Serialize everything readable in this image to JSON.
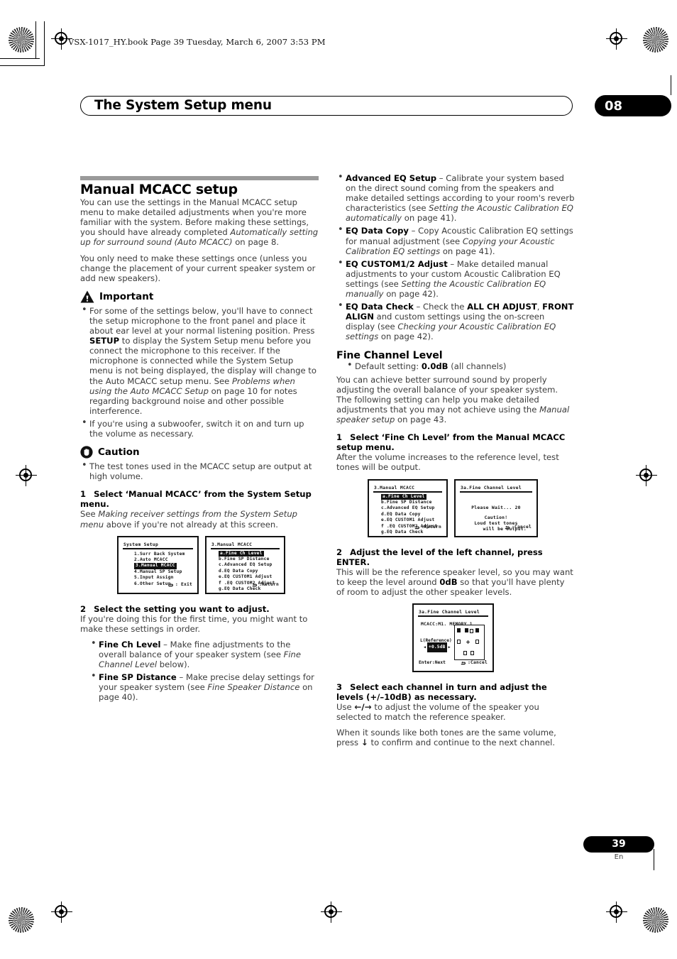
{
  "header": {
    "book_line": "VSX-1017_HY.book  Page 39  Tuesday, March 6, 2007  3:53 PM",
    "chapter_title": "The System Setup menu",
    "chapter_number": "08"
  },
  "footer": {
    "page_number": "39",
    "language": "En"
  },
  "left_column": {
    "section_title": "Manual MCACC setup",
    "intro_p1_a": "You can use the settings in the Manual MCACC setup menu to make detailed adjustments when you're more familiar with the system. Before making these settings, you should have already completed ",
    "intro_p1_italic": "Automatically setting up for surround sound (Auto MCACC)",
    "intro_p1_b": " on page 8.",
    "intro_p2": "You only need to make these settings once (unless you change the placement of your current speaker system or add new speakers).",
    "important_label": "Important",
    "important_bullet_1_a": "For some of the settings below, you'll have to connect the setup microphone to the front panel and place it about ear level at your normal listening position. Press ",
    "important_bullet_1_b": "SETUP",
    "important_bullet_1_c": " to display the System Setup menu before you connect the microphone to this receiver. If the microphone is connected while the System Setup menu is not being displayed, the display will change to the Auto MCACC setup menu. See ",
    "important_bullet_1_italic": "Problems when using the Auto MCACC Setup",
    "important_bullet_1_d": " on page 10 for notes regarding background noise and other possible interference.",
    "important_bullet_2": "If you're using a subwoofer, switch it on and turn up the volume as necessary.",
    "caution_label": "Caution",
    "caution_bullet_1": "The test tones used in the MCACC setup are output at high volume.",
    "step1_num": "1",
    "step1_title": "Select ‘Manual MCACC’ from the System Setup menu.",
    "step1_body_a": "See ",
    "step1_body_italic": "Making receiver settings from the System Setup menu",
    "step1_body_b": " above if you're not already at this screen.",
    "step2_num": "2",
    "step2_title": "Select the setting you want to adjust.",
    "step2_body": "If you're doing this for the first time, you might want to make these settings in order.",
    "step2_bullets": [
      {
        "bold": "Fine Ch Level",
        "text_a": " – Make fine adjustments to the overall balance of your speaker system (see ",
        "italic": "Fine Channel Level",
        "text_b": " below)."
      },
      {
        "bold": "Fine SP Distance",
        "text_a": " – Make precise delay settings for your speaker system (see ",
        "italic": "Fine Speaker Distance",
        "text_b": " on page 40)."
      }
    ]
  },
  "right_column": {
    "bullets": [
      {
        "bold": "Advanced EQ Setup",
        "text_a": " – Calibrate your system based on the direct sound coming from the speakers and make detailed settings according to your room's reverb characteristics (see ",
        "italic": "Setting the Acoustic Calibration EQ automatically",
        "text_b": " on page 41)."
      },
      {
        "bold": "EQ Data Copy",
        "text_a": " – Copy Acoustic Calibration EQ settings for manual adjustment (see ",
        "italic": "Copying your Acoustic Calibration EQ settings",
        "text_b": " on page 41)."
      },
      {
        "bold": "EQ CUSTOM1/2 Adjust",
        "text_a": " – Make detailed manual adjustments to your custom Acoustic Calibration EQ settings (see ",
        "italic": "Setting the Acoustic Calibration EQ manually",
        "text_b": " on page 42)."
      }
    ],
    "eq_data_check": {
      "bold": "EQ Data Check",
      "text_a": " – Check the ",
      "bold2": "ALL CH ADJUST",
      "text_b": ", ",
      "bold3": "FRONT ALIGN",
      "text_c": " and custom settings using the on-screen display (see ",
      "italic": "Checking your Acoustic Calibration EQ settings",
      "text_d": " on page 42)."
    },
    "sub_title": "Fine Channel Level",
    "default_bullet_a": "Default setting: ",
    "default_bullet_bold": "0.0dB",
    "default_bullet_b": " (all channels)",
    "body_p1_a": "You can achieve better surround sound by properly adjusting the overall balance of your speaker system. The following setting can help you make detailed adjustments that you may not achieve using the ",
    "body_p1_italic": "Manual speaker setup",
    "body_p1_b": " on page 43.",
    "step1_num": "1",
    "step1_title": "Select ‘Fine Ch Level’ from the Manual MCACC setup menu.",
    "step1_body": "After the volume increases to the reference level, test tones will be output.",
    "step2_num": "2",
    "step2_title": "Adjust the level of the left channel, press ENTER.",
    "step2_body_a": "This will be the reference speaker level, so you may want to keep the level around ",
    "step2_body_bold": "0dB",
    "step2_body_b": " so that you'll have plenty of room to adjust the other speaker levels.",
    "step3_num": "3",
    "step3_title": "Select each channel in turn and adjust the levels (+/–10dB) as necessary.",
    "step3_body_a": "Use ",
    "step3_arrow_left": "←",
    "step3_arrow_slash": "/",
    "step3_arrow_right": "→",
    "step3_body_b": " to adjust the volume of the speaker you selected to match the reference speaker.",
    "step3_body2_a": "When it sounds like both tones are the same volume, press ",
    "step3_arrow_down": "↓",
    "step3_body2_b": " to confirm and continue to the next channel."
  },
  "osd_screens": {
    "system_setup": {
      "title": "System Setup",
      "items": [
        {
          "label": "1.Surr Back System",
          "highlighted": false
        },
        {
          "label": "2.Auto MCACC",
          "highlighted": false
        },
        {
          "label": "3.Manual MCACC",
          "highlighted": true
        },
        {
          "label": "4.Manual SP Setup",
          "highlighted": false
        },
        {
          "label": "5.Input Assign",
          "highlighted": false
        },
        {
          "label": "6.Other Setup",
          "highlighted": false
        }
      ],
      "footer": ": Exit"
    },
    "manual_mcacc": {
      "title": "3.Manual MCACC",
      "items": [
        {
          "label": "a.Fine Ch Level",
          "highlighted": true
        },
        {
          "label": "b.Fine SP Distance",
          "highlighted": false
        },
        {
          "label": "c.Advanced EQ Setup",
          "highlighted": false
        },
        {
          "label": "d.EQ Data Copy",
          "highlighted": false
        },
        {
          "label": "e.EQ CUSTOM1 Adjust",
          "highlighted": false
        },
        {
          "label": "f .EQ CUSTOM2 Adjust",
          "highlighted": false
        },
        {
          "label": "g.EQ Data Check",
          "highlighted": false
        }
      ],
      "footer": ":Return"
    },
    "manual_mcacc_2": {
      "title": "3.Manual MCACC",
      "items": [
        {
          "label": "a.Fine Ch Level",
          "highlighted": true
        },
        {
          "label": "b.Fine SP Distance",
          "highlighted": false
        },
        {
          "label": "c.Advanced EQ Setup",
          "highlighted": false
        },
        {
          "label": "d.EQ Data Copy",
          "highlighted": false
        },
        {
          "label": "e.EQ CUSTOM1 Adjust",
          "highlighted": false
        },
        {
          "label": "f .EQ CUSTOM2 Adjust",
          "highlighted": false
        },
        {
          "label": "g.EQ Data Check",
          "highlighted": false
        }
      ],
      "footer": ":Return"
    },
    "fine_channel_wait": {
      "title": "3a.Fine Channel Level",
      "wait_text": "Please Wait...  20",
      "caution_text": "Caution!",
      "line1": "Loud test tones",
      "line2": "will be output.",
      "footer": ":Cancel"
    },
    "fine_channel_adjust": {
      "title": "3a.Fine Channel Level",
      "memory": "MCACC:M1. MEMORY 1",
      "channel_label": "L(Reference)",
      "value": "+0.5dB",
      "left_arrow": "◀",
      "right_arrow": "▶",
      "footer_left": "Enter:Next",
      "footer_right": ":Cancel"
    }
  }
}
